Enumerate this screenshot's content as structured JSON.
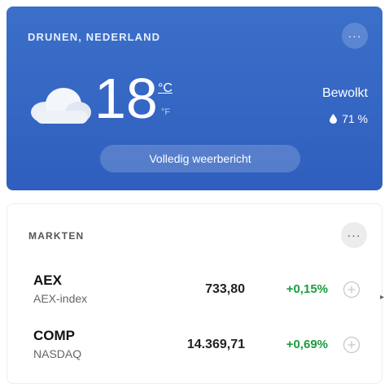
{
  "weather": {
    "location": "DRUNEN, NEDERLAND",
    "more_label": "···",
    "temperature": "18",
    "unit_celsius": "°C",
    "unit_fahrenheit": "°F",
    "condition": "Bewolkt",
    "humidity": "71 %",
    "forecast_button": "Volledig weerbericht",
    "icon": "cloud-icon"
  },
  "markets": {
    "title": "MARKTEN",
    "more_label": "···",
    "rows": [
      {
        "symbol": "AEX",
        "name": "AEX-index",
        "price": "733,80",
        "change": "+0,15%"
      },
      {
        "symbol": "COMP",
        "name": "NASDAQ",
        "price": "14.369,71",
        "change": "+0,69%"
      }
    ],
    "colors": {
      "positive": "#1a9c3e"
    }
  },
  "side_arrow": "▸"
}
